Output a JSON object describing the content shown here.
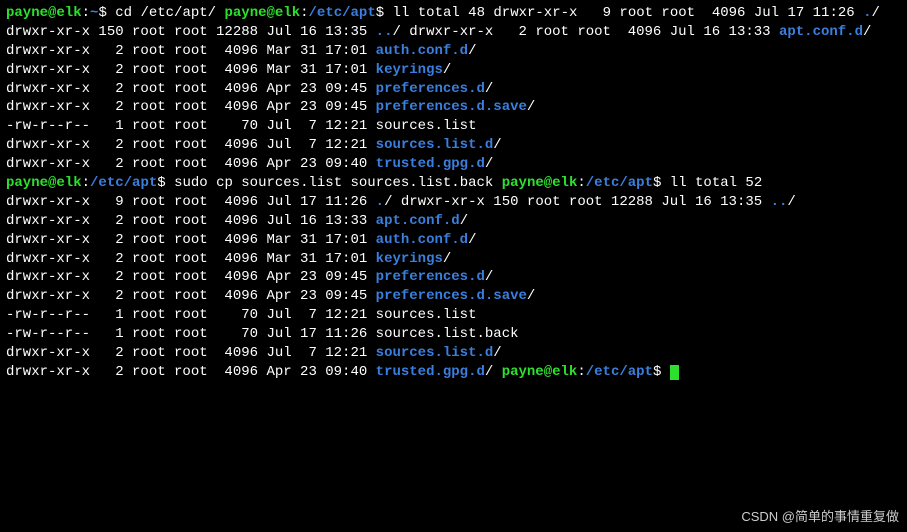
{
  "prompt1": {
    "user": "payne@elk",
    "path": "~",
    "cmd": "cd /etc/apt/"
  },
  "prompt2": {
    "user": "payne@elk",
    "path": "/etc/apt",
    "cmd": "ll"
  },
  "total1": "total 48",
  "listing1": [
    {
      "perm": "drwxr-xr-x",
      "links": "  9",
      "owner": "root",
      "group": "root",
      "size": " 4096",
      "date": "Jul 17 11:26",
      "name": ".",
      "suffix": "/",
      "color": "blue"
    },
    {
      "perm": "drwxr-xr-x",
      "links": "150",
      "owner": "root",
      "group": "root",
      "size": "12288",
      "date": "Jul 16 13:35",
      "name": "..",
      "suffix": "/",
      "color": "blue"
    },
    {
      "perm": "drwxr-xr-x",
      "links": "  2",
      "owner": "root",
      "group": "root",
      "size": " 4096",
      "date": "Jul 16 13:33",
      "name": "apt.conf.d",
      "suffix": "/",
      "color": "blue"
    },
    {
      "perm": "drwxr-xr-x",
      "links": "  2",
      "owner": "root",
      "group": "root",
      "size": " 4096",
      "date": "Mar 31 17:01",
      "name": "auth.conf.d",
      "suffix": "/",
      "color": "blue"
    },
    {
      "perm": "drwxr-xr-x",
      "links": "  2",
      "owner": "root",
      "group": "root",
      "size": " 4096",
      "date": "Mar 31 17:01",
      "name": "keyrings",
      "suffix": "/",
      "color": "blue"
    },
    {
      "perm": "drwxr-xr-x",
      "links": "  2",
      "owner": "root",
      "group": "root",
      "size": " 4096",
      "date": "Apr 23 09:45",
      "name": "preferences.d",
      "suffix": "/",
      "color": "blue"
    },
    {
      "perm": "drwxr-xr-x",
      "links": "  2",
      "owner": "root",
      "group": "root",
      "size": " 4096",
      "date": "Apr 23 09:45",
      "name": "preferences.d.save",
      "suffix": "/",
      "color": "blue"
    },
    {
      "perm": "-rw-r--r--",
      "links": "  1",
      "owner": "root",
      "group": "root",
      "size": "   70",
      "date": "Jul  7 12:21",
      "name": "sources.list",
      "suffix": "",
      "color": ""
    },
    {
      "perm": "drwxr-xr-x",
      "links": "  2",
      "owner": "root",
      "group": "root",
      "size": " 4096",
      "date": "Jul  7 12:21",
      "name": "sources.list.d",
      "suffix": "/",
      "color": "blue"
    },
    {
      "perm": "drwxr-xr-x",
      "links": "  2",
      "owner": "root",
      "group": "root",
      "size": " 4096",
      "date": "Apr 23 09:40",
      "name": "trusted.gpg.d",
      "suffix": "/",
      "color": "blue"
    }
  ],
  "prompt3": {
    "user": "payne@elk",
    "path": "/etc/apt",
    "cmd": "sudo cp sources.list sources.list.back"
  },
  "prompt4": {
    "user": "payne@elk",
    "path": "/etc/apt",
    "cmd": "ll"
  },
  "total2": "total 52",
  "listing2": [
    {
      "perm": "drwxr-xr-x",
      "links": "  9",
      "owner": "root",
      "group": "root",
      "size": " 4096",
      "date": "Jul 17 11:26",
      "name": ".",
      "suffix": "/",
      "color": "blue"
    },
    {
      "perm": "drwxr-xr-x",
      "links": "150",
      "owner": "root",
      "group": "root",
      "size": "12288",
      "date": "Jul 16 13:35",
      "name": "..",
      "suffix": "/",
      "color": "blue"
    },
    {
      "perm": "drwxr-xr-x",
      "links": "  2",
      "owner": "root",
      "group": "root",
      "size": " 4096",
      "date": "Jul 16 13:33",
      "name": "apt.conf.d",
      "suffix": "/",
      "color": "blue"
    },
    {
      "perm": "drwxr-xr-x",
      "links": "  2",
      "owner": "root",
      "group": "root",
      "size": " 4096",
      "date": "Mar 31 17:01",
      "name": "auth.conf.d",
      "suffix": "/",
      "color": "blue"
    },
    {
      "perm": "drwxr-xr-x",
      "links": "  2",
      "owner": "root",
      "group": "root",
      "size": " 4096",
      "date": "Mar 31 17:01",
      "name": "keyrings",
      "suffix": "/",
      "color": "blue"
    },
    {
      "perm": "drwxr-xr-x",
      "links": "  2",
      "owner": "root",
      "group": "root",
      "size": " 4096",
      "date": "Apr 23 09:45",
      "name": "preferences.d",
      "suffix": "/",
      "color": "blue"
    },
    {
      "perm": "drwxr-xr-x",
      "links": "  2",
      "owner": "root",
      "group": "root",
      "size": " 4096",
      "date": "Apr 23 09:45",
      "name": "preferences.d.save",
      "suffix": "/",
      "color": "blue"
    },
    {
      "perm": "-rw-r--r--",
      "links": "  1",
      "owner": "root",
      "group": "root",
      "size": "   70",
      "date": "Jul  7 12:21",
      "name": "sources.list",
      "suffix": "",
      "color": ""
    },
    {
      "perm": "-rw-r--r--",
      "links": "  1",
      "owner": "root",
      "group": "root",
      "size": "   70",
      "date": "Jul 17 11:26",
      "name": "sources.list.back",
      "suffix": "",
      "color": ""
    },
    {
      "perm": "drwxr-xr-x",
      "links": "  2",
      "owner": "root",
      "group": "root",
      "size": " 4096",
      "date": "Jul  7 12:21",
      "name": "sources.list.d",
      "suffix": "/",
      "color": "blue"
    },
    {
      "perm": "drwxr-xr-x",
      "links": "  2",
      "owner": "root",
      "group": "root",
      "size": " 4096",
      "date": "Apr 23 09:40",
      "name": "trusted.gpg.d",
      "suffix": "/",
      "color": "blue"
    }
  ],
  "prompt5": {
    "user": "payne@elk",
    "path": "/etc/apt",
    "cmd": ""
  },
  "watermark": "CSDN @简单的事情重复做"
}
